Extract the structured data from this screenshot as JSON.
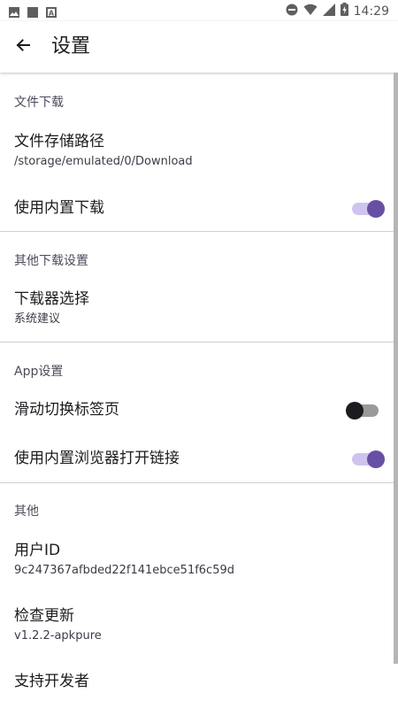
{
  "status_bar": {
    "time": "14:29",
    "left_icons": [
      "image-icon",
      "square-icon",
      "a-box-icon"
    ],
    "right_icons": [
      "dnd-icon",
      "wifi-icon",
      "signal-icon",
      "battery-icon"
    ]
  },
  "app_bar": {
    "back_icon": "arrow-left-icon",
    "title": "设置"
  },
  "sections": [
    {
      "header": "文件下载",
      "items": [
        {
          "title": "文件存储路径",
          "subtitle": "/storage/emulated/0/Download"
        },
        {
          "title": "使用内置下载",
          "toggle": true
        }
      ]
    },
    {
      "header": "其他下载设置",
      "items": [
        {
          "title": "下载器选择",
          "subtitle": "系统建议"
        }
      ]
    },
    {
      "header": "App设置",
      "items": [
        {
          "title": "滑动切换标签页",
          "toggle": false
        },
        {
          "title": "使用内置浏览器打开链接",
          "toggle": true
        }
      ]
    },
    {
      "header": "其他",
      "items": [
        {
          "title": "用户ID",
          "subtitle": "9c247367afbded22f141ebce51f6c59d"
        },
        {
          "title": "检查更新",
          "subtitle": "v1.2.2-apkpure"
        },
        {
          "title": "支持开发者"
        }
      ]
    }
  ],
  "colors": {
    "accent": "#6750a4",
    "accent_track": "#cec4ef",
    "off_thumb": "#1c1b1f",
    "off_track": "#9a9a9a",
    "divider": "#cfcfcf",
    "section_header": "#4e4a5a"
  }
}
